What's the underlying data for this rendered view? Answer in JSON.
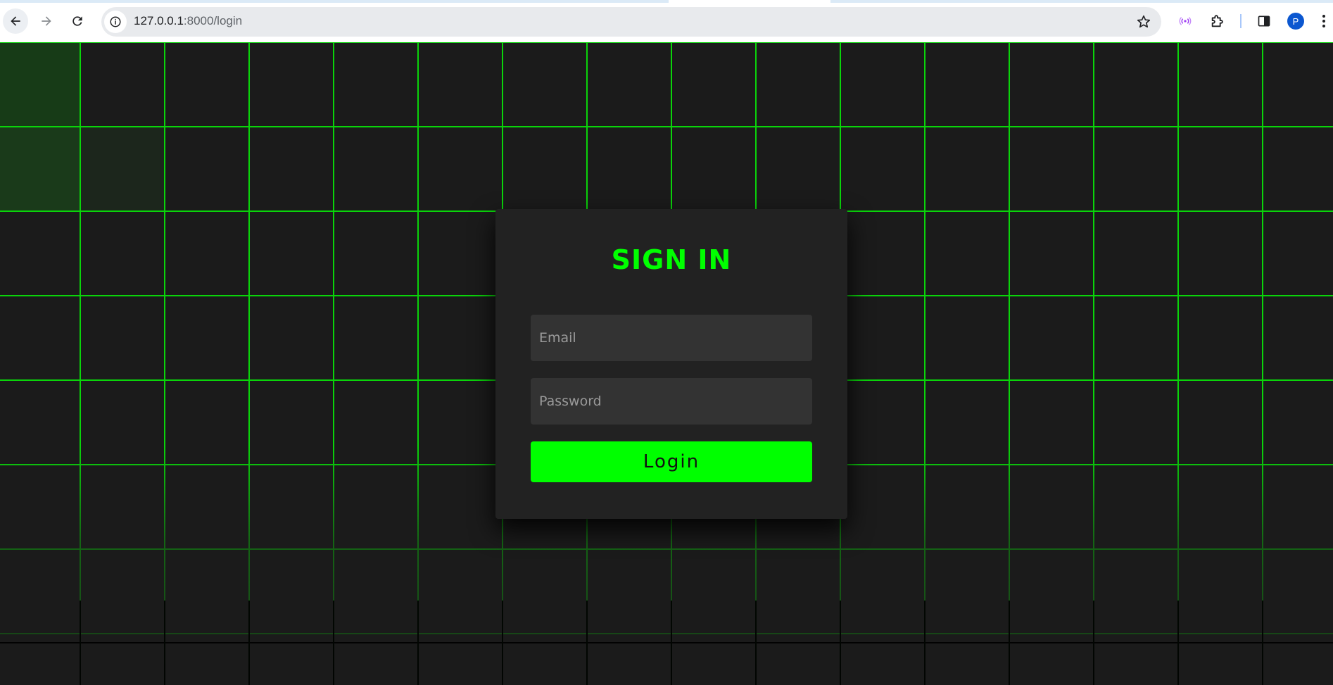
{
  "browser": {
    "url_host": "127.0.0.1",
    "url_path": ":8000/login",
    "profile_initial": "P",
    "icons": {
      "back": "arrow-left-icon",
      "forward": "arrow-right-icon",
      "reload": "reload-icon",
      "site_info": "info-icon",
      "bookmark": "star-icon",
      "cast": "cast-icon",
      "extensions": "puzzle-icon",
      "side_panel": "side-panel-icon",
      "menu": "more-vertical-icon"
    }
  },
  "login": {
    "title": "SIGN IN",
    "email_placeholder": "Email",
    "email_value": "",
    "password_placeholder": "Password",
    "password_value": "",
    "submit_label": "Login"
  },
  "colors": {
    "accent": "#00ff00",
    "page_background": "#1b1b1b",
    "card_background": "#222222",
    "input_background": "#333333"
  }
}
